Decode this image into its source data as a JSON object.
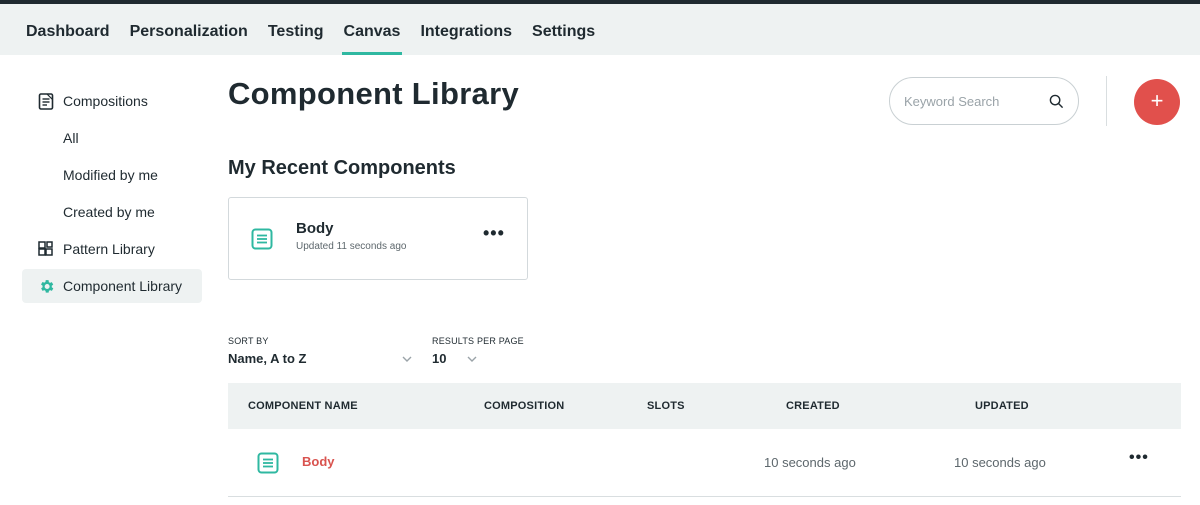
{
  "nav": {
    "tabs": [
      {
        "label": "Dashboard"
      },
      {
        "label": "Personalization"
      },
      {
        "label": "Testing"
      },
      {
        "label": "Canvas",
        "active": true
      },
      {
        "label": "Integrations"
      },
      {
        "label": "Settings"
      }
    ]
  },
  "sidebar": {
    "items": [
      {
        "label": "Compositions",
        "icon": "document-icon"
      },
      {
        "label": "All"
      },
      {
        "label": "Modified by me"
      },
      {
        "label": "Created by me"
      },
      {
        "label": "Pattern Library",
        "icon": "pattern-grid-icon"
      },
      {
        "label": "Component Library",
        "icon": "gear-icon",
        "active": true
      }
    ]
  },
  "header": {
    "title": "Component Library",
    "search_placeholder": "Keyword Search",
    "add_label": "+"
  },
  "recent": {
    "title": "My Recent Components",
    "cards": [
      {
        "name": "Body",
        "updated": "Updated 11 seconds ago",
        "more": "•••"
      }
    ]
  },
  "controls": {
    "sort_label": "SORT BY",
    "sort_value": "Name, A to Z",
    "per_page_label": "RESULTS PER PAGE",
    "per_page_value": "10"
  },
  "table": {
    "columns": [
      "COMPONENT NAME",
      "COMPOSITION",
      "SLOTS",
      "CREATED",
      "UPDATED"
    ],
    "rows": [
      {
        "name": "Body",
        "composition": "",
        "slots": "",
        "created": "10 seconds ago",
        "updated": "10 seconds ago",
        "more": "•••"
      }
    ]
  },
  "colors": {
    "accent": "#2fb8a1",
    "danger": "#e1504c",
    "text": "#1f2a30",
    "subtle_bg": "#eef2f2"
  }
}
